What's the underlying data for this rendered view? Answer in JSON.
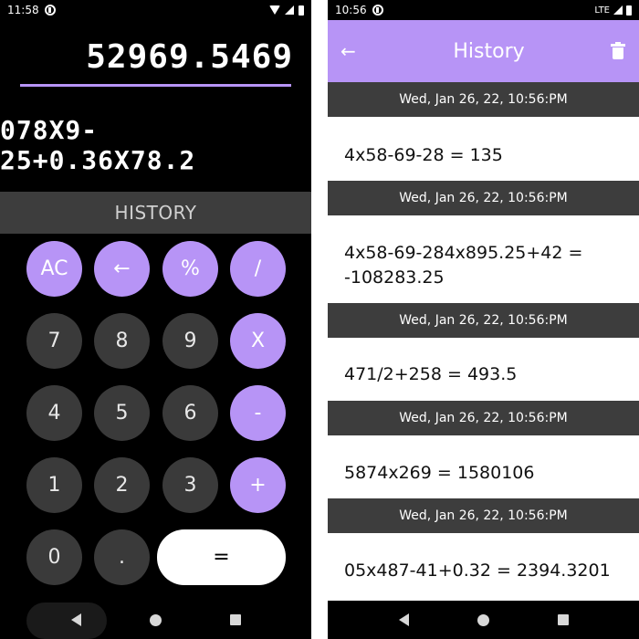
{
  "left": {
    "status": {
      "time": "11:58"
    },
    "result": "52969.5469",
    "expression": "078X9-25+0.36X78.2",
    "history_label": "HISTORY",
    "keys": {
      "ac": "AC",
      "back": "←",
      "percent": "%",
      "divide": "/",
      "k7": "7",
      "k8": "8",
      "k9": "9",
      "multiply": "X",
      "k4": "4",
      "k5": "5",
      "k6": "6",
      "minus": "-",
      "k1": "1",
      "k2": "2",
      "k3": "3",
      "plus": "+",
      "k0": "0",
      "dot": ".",
      "equals": "="
    },
    "colors": {
      "accent": "#b794f6",
      "key_bg": "#3a3a3a",
      "background": "#000000"
    }
  },
  "right": {
    "status": {
      "time": "10:56",
      "network": "LTE"
    },
    "appbar": {
      "title": "History",
      "back": "←"
    },
    "history": [
      {
        "date": "Wed, Jan 26, 22, 10:56:PM",
        "entry": "4x58-69-28 = 135"
      },
      {
        "date": "Wed, Jan 26, 22, 10:56:PM",
        "entry": "4x58-69-284x895.25+42 = -108283.25"
      },
      {
        "date": "Wed, Jan 26, 22, 10:56:PM",
        "entry": "471/2+258 = 493.5"
      },
      {
        "date": "Wed, Jan 26, 22, 10:56:PM",
        "entry": "5874x269 = 1580106"
      },
      {
        "date": "Wed, Jan 26, 22, 10:56:PM",
        "entry": "05x487-41+0.32 = 2394.3201"
      }
    ],
    "colors": {
      "appbar": "#b794f6",
      "date_bar": "#3d3d3d"
    }
  }
}
